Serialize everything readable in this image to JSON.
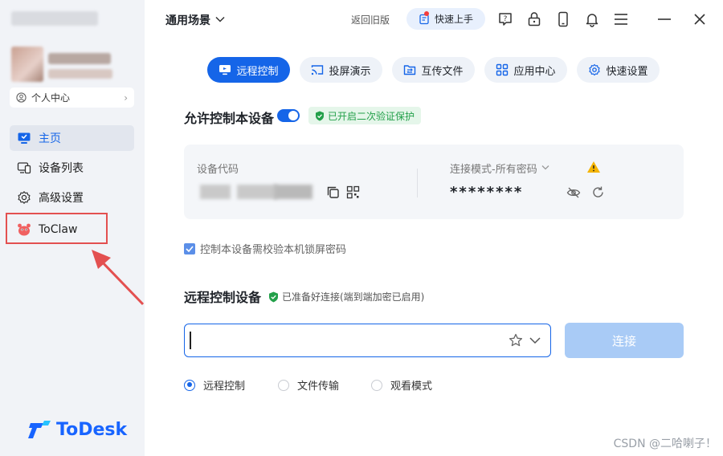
{
  "sidebar": {
    "profile_link_label": "个人中心",
    "nav": [
      {
        "label": "主页",
        "icon": "monitor-icon",
        "active": true
      },
      {
        "label": "设备列表",
        "icon": "device-list-icon",
        "active": false
      },
      {
        "label": "高级设置",
        "icon": "gear-icon",
        "active": false
      },
      {
        "label": "ToClaw",
        "icon": "crab-icon",
        "active": false
      }
    ],
    "logo_text": "ToDesk"
  },
  "topbar": {
    "scene_label": "通用场景",
    "legacy_label": "返回旧版",
    "quickstart_label": "快速上手",
    "icons": [
      "help-icon",
      "lock-icon",
      "phone-icon",
      "bell-icon",
      "menu-icon",
      "minimize-icon",
      "close-icon"
    ]
  },
  "tabs": [
    {
      "label": "远程控制",
      "icon": "remote-control-icon",
      "active": true
    },
    {
      "label": "投屏演示",
      "icon": "cast-icon",
      "active": false
    },
    {
      "label": "互传文件",
      "icon": "file-transfer-icon",
      "active": false
    },
    {
      "label": "应用中心",
      "icon": "app-grid-icon",
      "active": false
    },
    {
      "label": "快速设置",
      "icon": "settings-icon",
      "active": false
    }
  ],
  "allow_control": {
    "title": "允许控制本设备",
    "enabled": true,
    "badge": "已开启二次验证保护"
  },
  "device_card": {
    "code_label": "设备代码",
    "mode_label": "连接模式-所有密码",
    "password_masked": "********"
  },
  "lock_check": {
    "label": "控制本设备需校验本机锁屏密码",
    "checked": true
  },
  "remote_control": {
    "title": "远程控制设备",
    "status": "已准备好连接(端到端加密已启用)",
    "input_value": "",
    "connect_label": "连接",
    "modes": [
      {
        "label": "远程控制",
        "selected": true
      },
      {
        "label": "文件传输",
        "selected": false
      },
      {
        "label": "观看模式",
        "selected": false
      }
    ]
  },
  "watermark": "CSDN @二哈喇子！",
  "colors": {
    "accent": "#1565e8",
    "sidebar_bg": "#f1f3f7",
    "success": "#23a04a",
    "warning": "#f5b400",
    "annotation_red": "#e35050"
  }
}
